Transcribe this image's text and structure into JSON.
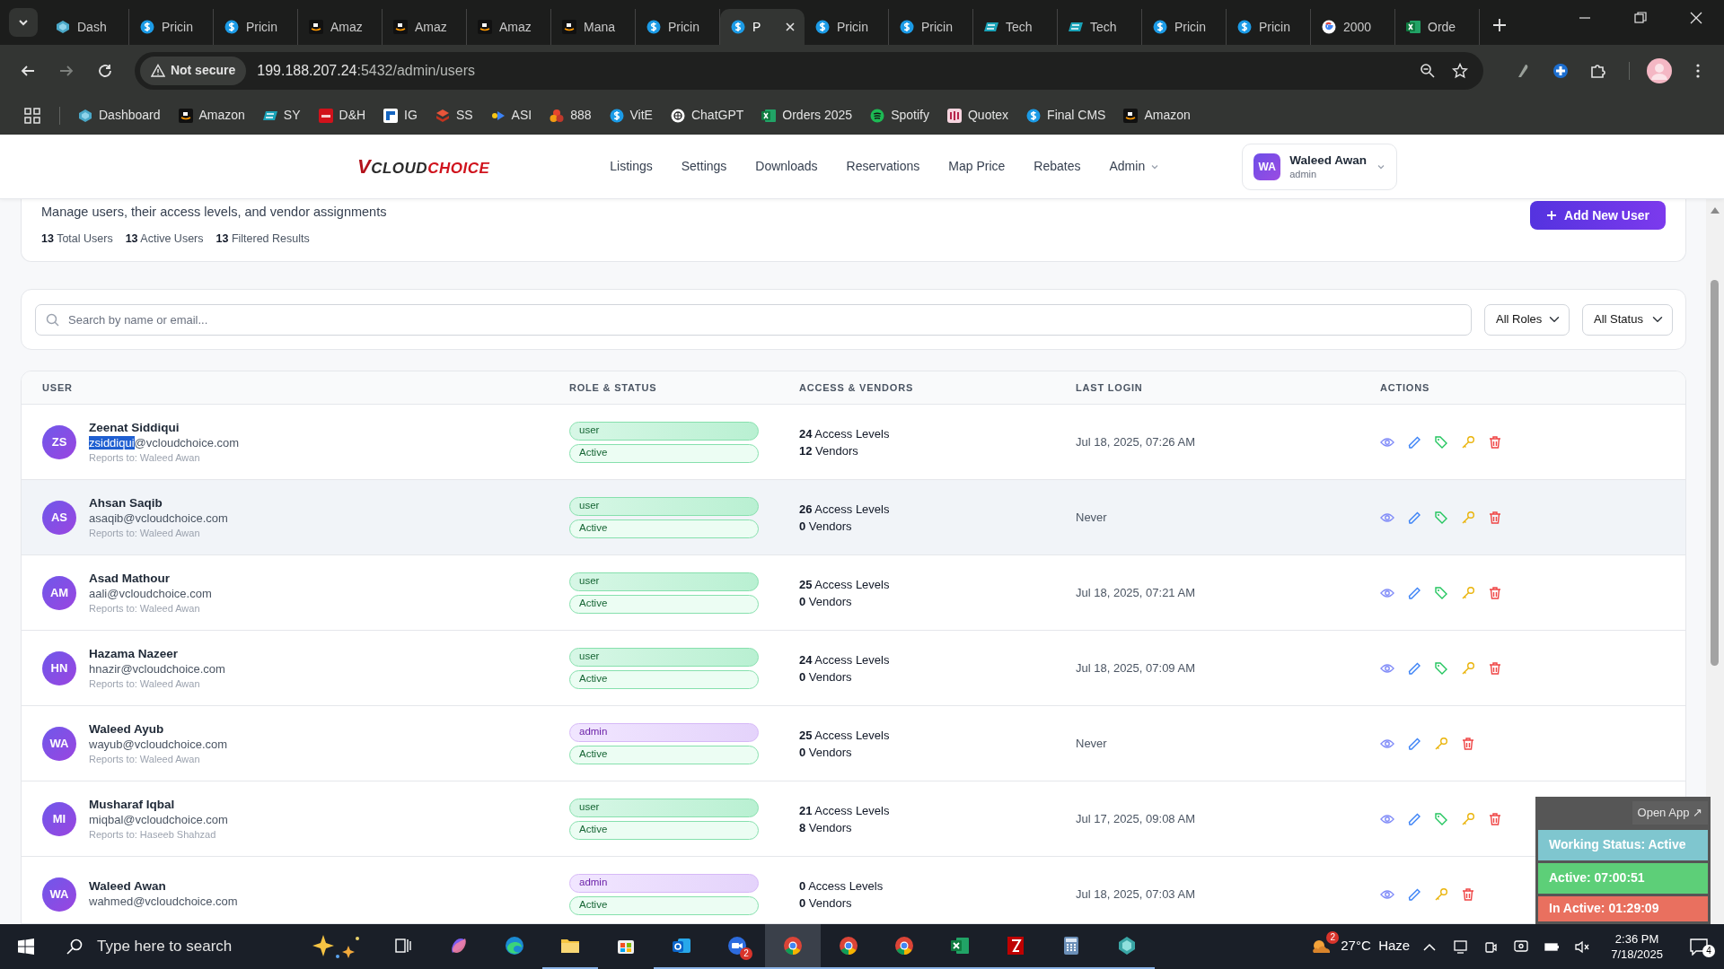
{
  "browser": {
    "tabs": [
      {
        "kind": "hexagon",
        "label": "Dash",
        "selected": false
      },
      {
        "kind": "coin",
        "label": "Pricin",
        "selected": false
      },
      {
        "kind": "coin",
        "label": "Pricin",
        "selected": false
      },
      {
        "kind": "smile",
        "label": "Amaz",
        "selected": false
      },
      {
        "kind": "smile",
        "label": "Amaz",
        "selected": false
      },
      {
        "kind": "smile",
        "label": "Amaz",
        "selected": false
      },
      {
        "kind": "smile",
        "label": "Mana",
        "selected": false
      },
      {
        "kind": "coin",
        "label": "Pricin",
        "selected": false
      },
      {
        "kind": "coin",
        "label": "P",
        "selected": true
      },
      {
        "kind": "coin",
        "label": "Pricin",
        "selected": false
      },
      {
        "kind": "coin",
        "label": "Pricin",
        "selected": false
      },
      {
        "kind": "slant",
        "label": "Tech",
        "selected": false
      },
      {
        "kind": "slant",
        "label": "Tech",
        "selected": false
      },
      {
        "kind": "coin",
        "label": "Pricin",
        "selected": false
      },
      {
        "kind": "coin",
        "label": "Pricin",
        "selected": false
      },
      {
        "kind": "ring",
        "label": "2000",
        "selected": false
      },
      {
        "kind": "sheet",
        "label": "Orde",
        "selected": false
      }
    ],
    "address": {
      "security": "Not secure",
      "host": "199.188.207.24",
      "path": ":5432/admin/users"
    },
    "bookmarks": [
      {
        "kind": "hexagon",
        "label": "Dashboard"
      },
      {
        "kind": "smile",
        "label": "Amazon"
      },
      {
        "kind": "slant",
        "label": "SY"
      },
      {
        "kind": "redsquare",
        "label": "D&H"
      },
      {
        "kind": "bluesquare",
        "label": "IG"
      },
      {
        "kind": "stack",
        "label": "SS"
      },
      {
        "kind": "play",
        "label": "ASI"
      },
      {
        "kind": "circles",
        "label": "888"
      },
      {
        "kind": "coin",
        "label": "VitE"
      },
      {
        "kind": "knot",
        "label": "ChatGPT"
      },
      {
        "kind": "sheet",
        "label": "Orders 2025"
      },
      {
        "kind": "waves",
        "label": "Spotify"
      },
      {
        "kind": "pinksquare",
        "label": "Quotex"
      },
      {
        "kind": "coin",
        "label": "Final CMS"
      },
      {
        "kind": "smile",
        "label": "Amazon"
      }
    ]
  },
  "header": {
    "logo": [
      "V",
      "CLOUD",
      "CHOICE"
    ],
    "nav": [
      {
        "label": "Listings",
        "kind": "link"
      },
      {
        "label": "Settings",
        "kind": "link"
      },
      {
        "label": "Downloads",
        "kind": "link"
      },
      {
        "label": "Reservations",
        "kind": "link"
      },
      {
        "label": "Map Price",
        "kind": "link"
      },
      {
        "label": "Rebates",
        "kind": "link"
      },
      {
        "label": "Admin",
        "kind": "dropdown"
      }
    ],
    "user": {
      "initials": "WA",
      "name": "Waleed Awan",
      "role": "admin"
    }
  },
  "summary": {
    "description": "Manage users, their access levels, and vendor assignments",
    "stats": [
      {
        "count": "13",
        "label": "Total Users"
      },
      {
        "count": "13",
        "label": "Active Users"
      },
      {
        "count": "13",
        "label": "Filtered Results"
      }
    ],
    "add_button": "Add New User"
  },
  "filters": {
    "search_placeholder": "Search by name or email...",
    "role_filter": "All Roles",
    "status_filter": "All Status"
  },
  "table": {
    "columns": [
      "USER",
      "ROLE & STATUS",
      "ACCESS & VENDORS",
      "LAST LOGIN",
      "ACTIONS"
    ],
    "rows": [
      {
        "initials": "ZS",
        "name": "Zeenat Siddiqui",
        "email_parts": [
          {
            "text": "zsiddiqui",
            "selected": true
          },
          {
            "text": "@vcloudchoice.com",
            "selected": false
          }
        ],
        "reports_to": "Reports to: Waleed Awan",
        "role": {
          "label": "user",
          "kind": "user"
        },
        "status": "Active",
        "access": "24 Access Levels",
        "vendors": "12 Vendors",
        "last_login": "Jul 18, 2025, 07:26 AM",
        "actions": [
          {
            "kind": "view"
          },
          {
            "kind": "edit"
          },
          {
            "kind": "tag"
          },
          {
            "kind": "key"
          },
          {
            "kind": "delete"
          }
        ],
        "highlighted": false
      },
      {
        "initials": "AS",
        "name": "Ahsan Saqib",
        "email_parts": [
          {
            "text": "asaqib@vcloudchoice.com",
            "selected": false
          }
        ],
        "reports_to": "Reports to: Waleed Awan",
        "role": {
          "label": "user",
          "kind": "user"
        },
        "status": "Active",
        "access": "26 Access Levels",
        "vendors": "0 Vendors",
        "last_login": "Never",
        "actions": [
          {
            "kind": "view"
          },
          {
            "kind": "edit"
          },
          {
            "kind": "tag"
          },
          {
            "kind": "key"
          },
          {
            "kind": "delete"
          }
        ],
        "highlighted": true
      },
      {
        "initials": "AM",
        "name": "Asad Mathour",
        "email_parts": [
          {
            "text": "aali@vcloudchoice.com",
            "selected": false
          }
        ],
        "reports_to": "Reports to: Waleed Awan",
        "role": {
          "label": "user",
          "kind": "user"
        },
        "status": "Active",
        "access": "25 Access Levels",
        "vendors": "0 Vendors",
        "last_login": "Jul 18, 2025, 07:21 AM",
        "actions": [
          {
            "kind": "view"
          },
          {
            "kind": "edit"
          },
          {
            "kind": "tag"
          },
          {
            "kind": "key"
          },
          {
            "kind": "delete"
          }
        ],
        "highlighted": false
      },
      {
        "initials": "HN",
        "name": "Hazama Nazeer",
        "email_parts": [
          {
            "text": "hnazir@vcloudchoice.com",
            "selected": false
          }
        ],
        "reports_to": "Reports to: Waleed Awan",
        "role": {
          "label": "user",
          "kind": "user"
        },
        "status": "Active",
        "access": "24 Access Levels",
        "vendors": "0 Vendors",
        "last_login": "Jul 18, 2025, 07:09 AM",
        "actions": [
          {
            "kind": "view"
          },
          {
            "kind": "edit"
          },
          {
            "kind": "tag"
          },
          {
            "kind": "key"
          },
          {
            "kind": "delete"
          }
        ],
        "highlighted": false
      },
      {
        "initials": "WA",
        "name": "Waleed Ayub",
        "email_parts": [
          {
            "text": "wayub@vcloudchoice.com",
            "selected": false
          }
        ],
        "reports_to": "Reports to: Waleed Awan",
        "role": {
          "label": "admin",
          "kind": "admin"
        },
        "status": "Active",
        "access": "25 Access Levels",
        "vendors": "0 Vendors",
        "last_login": "Never",
        "actions": [
          {
            "kind": "view"
          },
          {
            "kind": "edit"
          },
          {
            "kind": "key"
          },
          {
            "kind": "delete"
          }
        ],
        "highlighted": false
      },
      {
        "initials": "MI",
        "name": "Musharaf Iqbal",
        "email_parts": [
          {
            "text": "miqbal@vcloudchoice.com",
            "selected": false
          }
        ],
        "reports_to": "Reports to: Haseeb Shahzad",
        "role": {
          "label": "user",
          "kind": "user"
        },
        "status": "Active",
        "access": "21 Access Levels",
        "vendors": "8 Vendors",
        "last_login": "Jul 17, 2025, 09:08 AM",
        "actions": [
          {
            "kind": "view"
          },
          {
            "kind": "edit"
          },
          {
            "kind": "tag"
          },
          {
            "kind": "key"
          },
          {
            "kind": "delete"
          }
        ],
        "highlighted": false
      },
      {
        "initials": "WA",
        "name": "Waleed Awan",
        "email_parts": [
          {
            "text": "wahmed@vcloudchoice.com",
            "selected": false
          }
        ],
        "role": {
          "label": "admin",
          "kind": "admin"
        },
        "status": "Active",
        "access": "0 Access Levels",
        "vendors": "0 Vendors",
        "last_login": "Jul 18, 2025, 07:03 AM",
        "actions": [
          {
            "kind": "view"
          },
          {
            "kind": "edit"
          },
          {
            "kind": "key"
          },
          {
            "kind": "delete"
          }
        ],
        "highlighted": false
      }
    ]
  },
  "widget": {
    "open_link": "Open App ↗",
    "bars": [
      {
        "text": "Working Status: Active",
        "color": "#7fc6cf"
      },
      {
        "text": "Active: 07:00:51",
        "color": "#5dcf78"
      },
      {
        "text": "In Active: 01:29:09",
        "color": "#e9705f"
      }
    ]
  },
  "taskbar": {
    "search_placeholder": "Type here to search",
    "apps": [
      {
        "kind": "copilot",
        "running": false,
        "selected": false
      },
      {
        "kind": "edge",
        "running": false,
        "selected": false
      },
      {
        "kind": "folder",
        "running": true,
        "selected": false
      },
      {
        "kind": "store",
        "running": false,
        "selected": false
      },
      {
        "kind": "mail",
        "running": true,
        "selected": false
      },
      {
        "kind": "video",
        "running": true,
        "selected": false,
        "badge": "2"
      },
      {
        "kind": "browser",
        "running": true,
        "selected": true
      },
      {
        "kind": "browser",
        "running": true,
        "selected": false
      },
      {
        "kind": "browser",
        "running": true,
        "selected": false
      },
      {
        "kind": "sheet",
        "running": true,
        "selected": false
      },
      {
        "kind": "ftp",
        "running": true,
        "selected": false
      },
      {
        "kind": "calc",
        "running": true,
        "selected": false
      },
      {
        "kind": "gem",
        "running": true,
        "selected": false
      }
    ],
    "weather_badge": "2",
    "weather": "27°C  Haze",
    "time": "2:36 PM",
    "date": "7/18/2025",
    "notifications": "4"
  }
}
